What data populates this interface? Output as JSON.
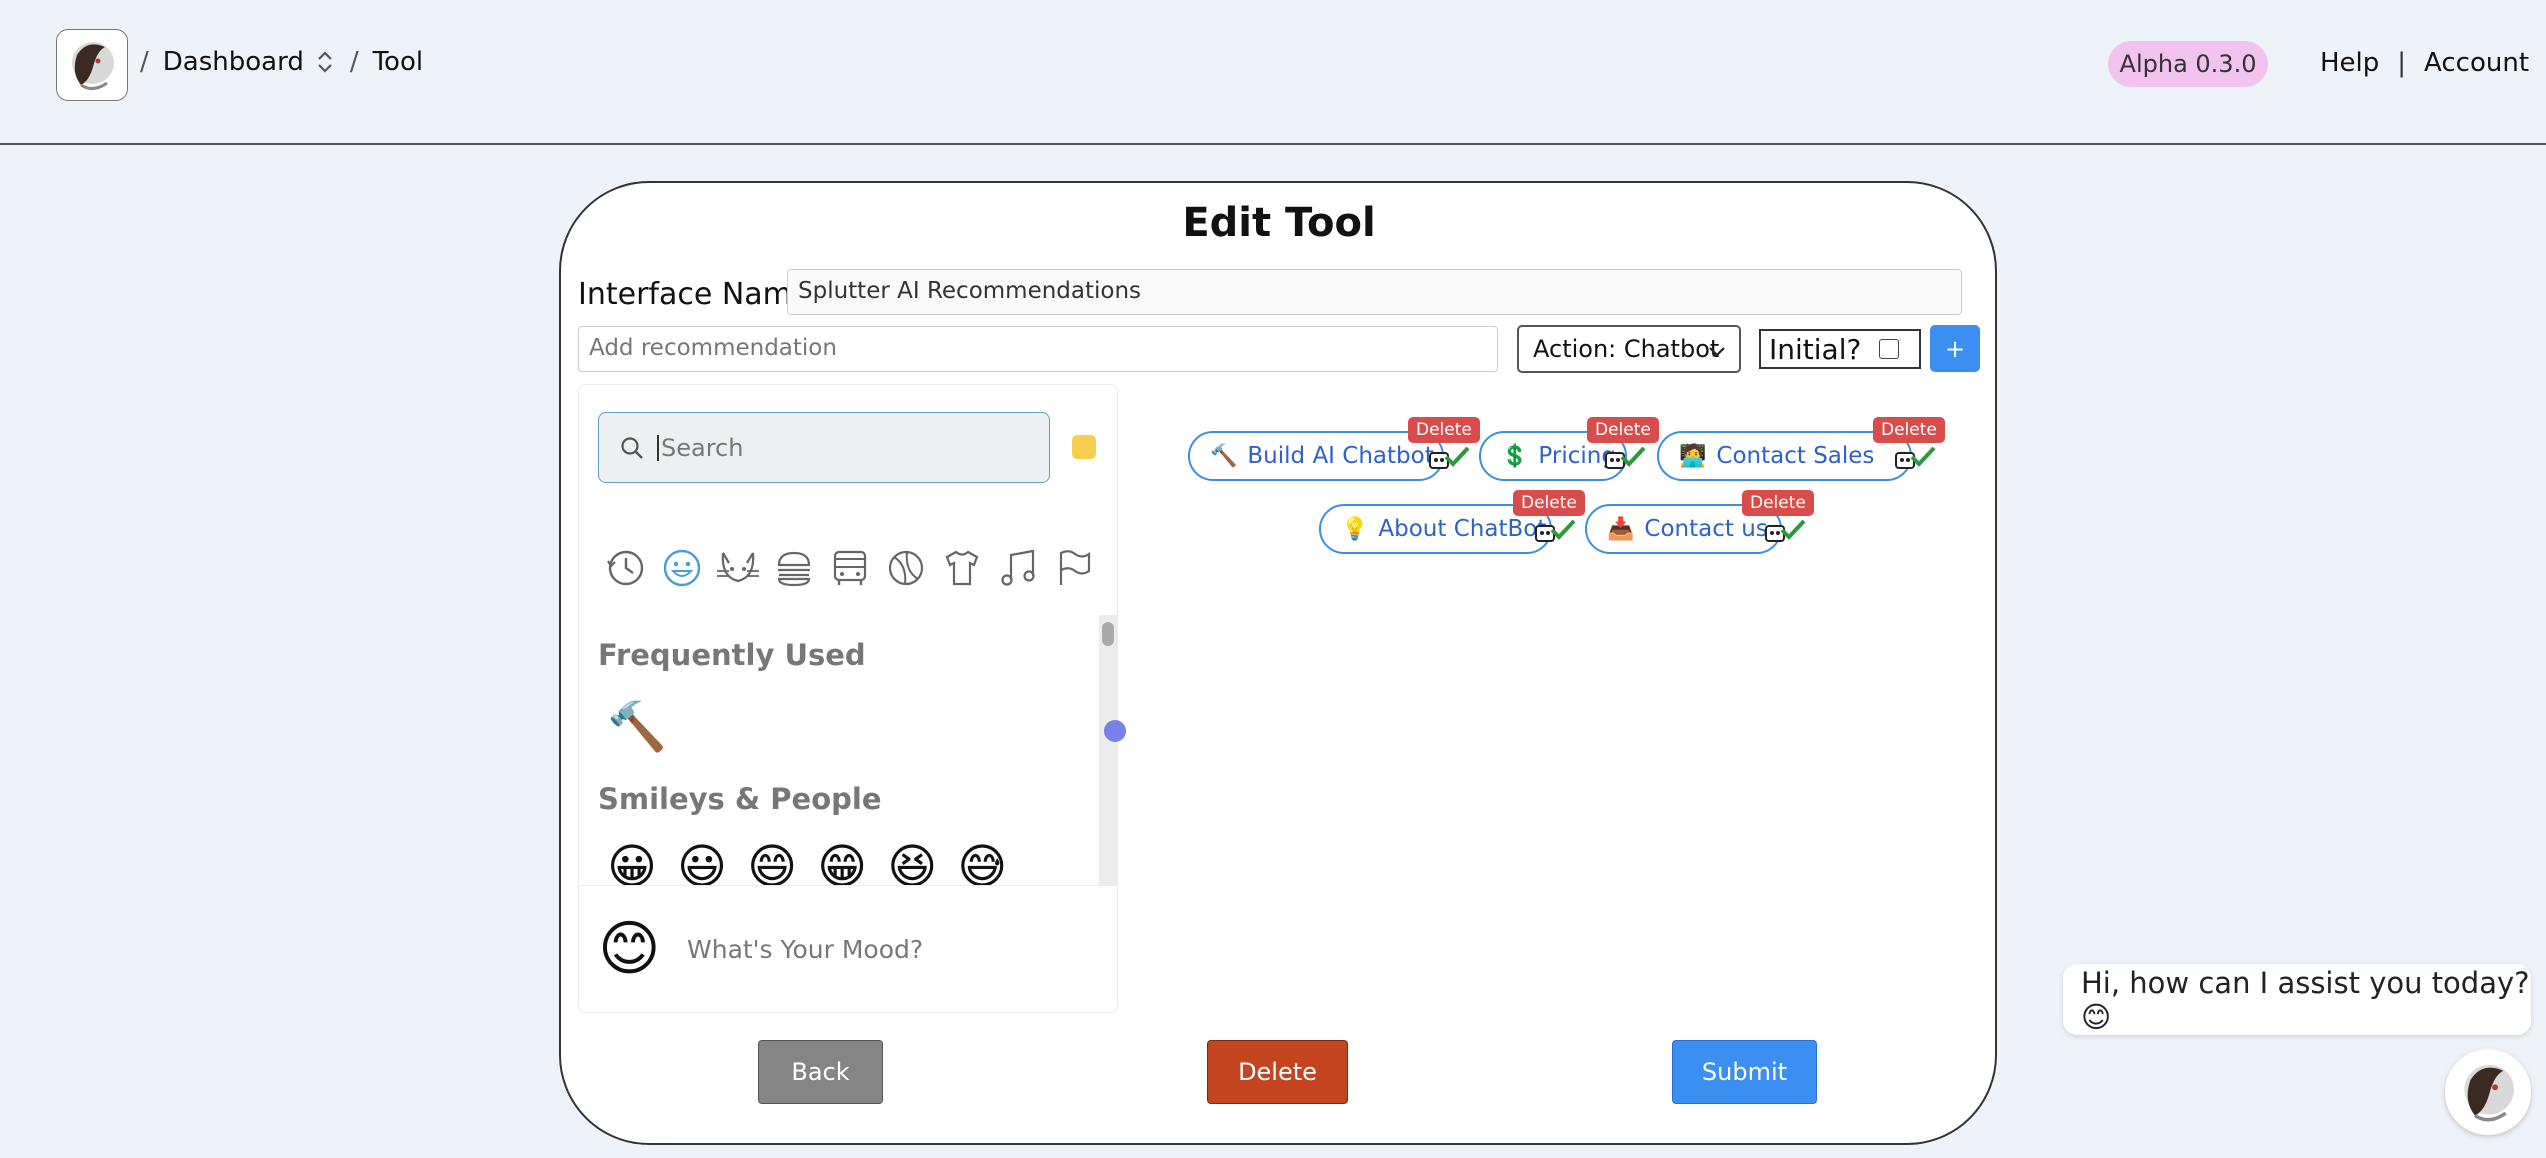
{
  "header": {
    "crumbs": [
      "/",
      "Dashboard",
      "/",
      "Tool"
    ],
    "version_badge": "Alpha 0.3.0",
    "help": "Help",
    "separator": "|",
    "account": "Account"
  },
  "editor": {
    "title": "Edit Tool",
    "interface_name_label": "Interface Name:",
    "interface_name_value": "Splutter AI Recommendations",
    "recommendation_placeholder": "Add recommendation",
    "action_select": "Action: Chatbot",
    "initial_label": "Initial?",
    "initial_checked": false,
    "add_button": "+"
  },
  "emoji_picker": {
    "search_placeholder": "Search",
    "skin_tone_color": "#f6d04d",
    "categories": [
      "recent-icon",
      "smileys-icon",
      "animals-icon",
      "food-icon",
      "travel-icon",
      "activities-icon",
      "objects-icon",
      "symbols-icon",
      "flags-icon"
    ],
    "active_category": "smileys-icon",
    "frequently_used_title": "Frequently Used",
    "frequently_used": [
      "🔨"
    ],
    "smileys_title": "Smileys & People",
    "smileys": [
      "😀",
      "😃",
      "😄",
      "😁",
      "😆",
      "😅"
    ],
    "preview_emoji": "😊",
    "preview_text": "What's Your Mood?"
  },
  "recommendations": [
    {
      "icon": "🔨",
      "label": "Build AI Chatbot",
      "delete": "Delete"
    },
    {
      "icon": "💲",
      "label": "Pricing",
      "delete": "Delete"
    },
    {
      "icon": "🧑‍💻",
      "label": "Contact Sales",
      "delete": "Delete"
    },
    {
      "icon": "💡",
      "label": "About ChatBot",
      "delete": "Delete"
    },
    {
      "icon": "📥",
      "label": "Contact us",
      "delete": "Delete"
    }
  ],
  "buttons": {
    "back": "Back",
    "delete": "Delete",
    "submit": "Submit"
  },
  "chat": {
    "greeting": "Hi, how can I assist you today? 😊"
  },
  "colors": {
    "primary": "#3b8ff0",
    "danger": "#c2451f",
    "badge": "#f3c3ef",
    "chip_border": "#3b8fe0",
    "delete_tag": "#d94c4c"
  }
}
